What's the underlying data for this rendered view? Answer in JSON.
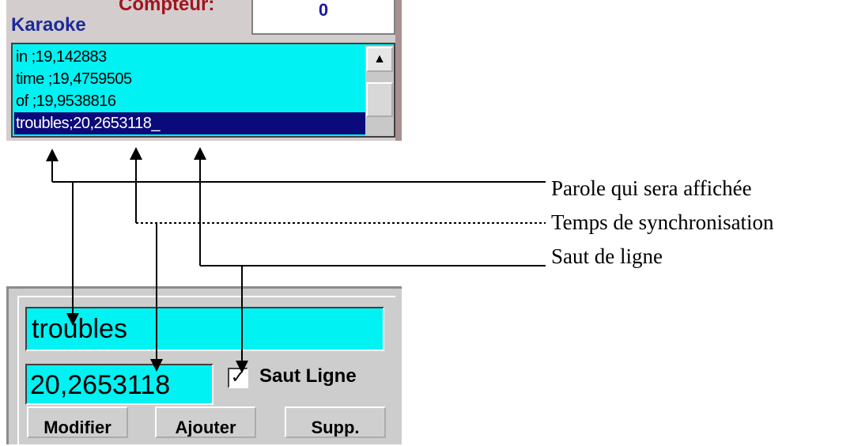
{
  "top": {
    "counter_label": "Compteur:",
    "counter_value": "0",
    "karaoke_title": "Karaoke"
  },
  "list": {
    "items": [
      "in ;19,142883",
      "time ;19,4759505",
      "of ;19,9538816",
      "troubles;20,2653118_"
    ],
    "selected_index": 3
  },
  "edit": {
    "word_value": "troubles",
    "time_value": "20,2653118",
    "saut_checked": true,
    "saut_mark": "✓",
    "saut_label": "Saut Ligne",
    "btn_modifier": "Modifier",
    "btn_ajouter": "Ajouter",
    "btn_supp": "Supp."
  },
  "annotations": {
    "parole": "Parole qui sera affichée",
    "temps": "Temps de synchronisation",
    "saut": "Saut de ligne"
  },
  "icons": {
    "scroll_up": "triangle-up-icon"
  },
  "colors": {
    "field_bg": "#00f2f2",
    "selection_bg": "#0a0a7a",
    "title_blue": "#1c2a9a",
    "counter_red": "#a0141e"
  }
}
